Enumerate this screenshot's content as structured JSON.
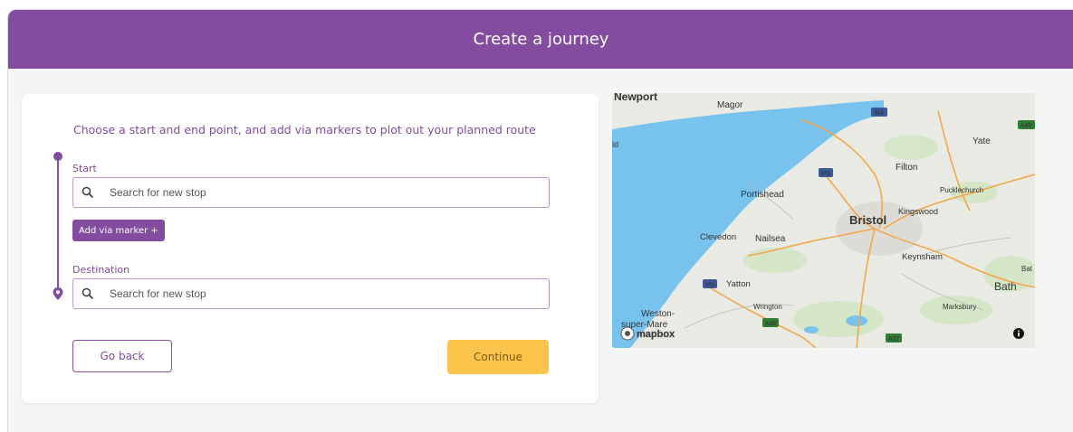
{
  "header": {
    "title": "Create a journey"
  },
  "form": {
    "instruction": "Choose a start and end point, and add via markers to plot out your planned route",
    "start_label": "Start",
    "start_placeholder": "Search for new stop",
    "via_button": "Add via marker +",
    "destination_label": "Destination",
    "destination_placeholder": "Search for new stop",
    "back_button": "Go back",
    "continue_button": "Continue"
  },
  "map": {
    "places": [
      "Newport",
      "Magor",
      "Yate",
      "Filton",
      "Portishead",
      "Pucklechurch",
      "Kingswood",
      "Bristol",
      "Clevedon",
      "Nailsea",
      "Keynsham",
      "Yatton",
      "Bath",
      "Wrington",
      "Marksbury",
      "Weston-",
      "super-Mare",
      "ld",
      "Bat"
    ],
    "road_shields": [
      "M4",
      "M5",
      "M5",
      "A38",
      "A37",
      "A46"
    ],
    "brand": "mapbox"
  },
  "colors": {
    "brand_purple": "#834c9f",
    "continue_yellow": "#fcc44a",
    "water": "#77c3ee",
    "land": "#e9eae3"
  }
}
